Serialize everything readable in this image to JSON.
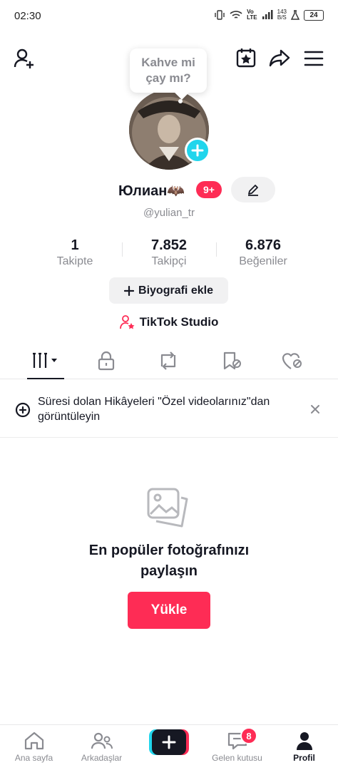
{
  "status_bar": {
    "time": "02:30",
    "network_speed": "143",
    "network_speed_unit": "B/S",
    "battery": "24"
  },
  "tooltip": {
    "text": "Kahve mi çay mı?"
  },
  "profile": {
    "display_name": "Юлиан🦇",
    "notification_badge": "9+",
    "username": "@yulian_tr"
  },
  "stats": [
    {
      "value": "1",
      "label": "Takipte"
    },
    {
      "value": "7.852",
      "label": "Takipçi"
    },
    {
      "value": "6.876",
      "label": "Beğeniler"
    }
  ],
  "bio_button": {
    "label": "Biyografi ekle"
  },
  "studio": {
    "label": "TikTok Studio"
  },
  "banner": {
    "text": "Süresi dolan Hikâyeleri \"Özel videolarınız\"dan görüntüleyin"
  },
  "empty_state": {
    "title": "En popüler fotoğrafınızı paylaşın",
    "button": "Yükle"
  },
  "bottom_nav": {
    "items": [
      {
        "label": "Ana sayfa"
      },
      {
        "label": "Arkadaşlar"
      },
      {
        "label": ""
      },
      {
        "label": "Gelen kutusu"
      },
      {
        "label": "Profil"
      }
    ],
    "inbox_badge": "8"
  },
  "colors": {
    "accent": "#fe2c55",
    "cyan": "#20d5ec",
    "text": "#161823",
    "secondary_text": "#8a8b91"
  }
}
